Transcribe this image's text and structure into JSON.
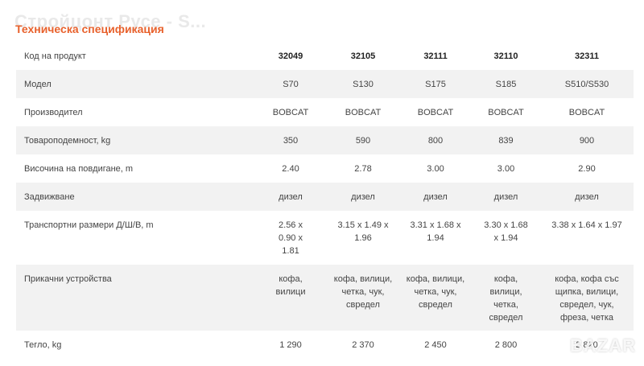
{
  "ghost_title": "Стройцонт Русе - S...",
  "section_title": "Техническа спецификация",
  "table": {
    "rows": [
      {
        "label": "Код на продукт",
        "values": [
          "32049",
          "32105",
          "32111",
          "32110",
          "32311"
        ]
      },
      {
        "label": "Модел",
        "values": [
          "S70",
          "S130",
          "S175",
          "S185",
          "S510/S530"
        ]
      },
      {
        "label": "Производител",
        "values": [
          "BOBCAT",
          "BOBCAT",
          "BOBCAT",
          "BOBCAT",
          "BOBCAT"
        ]
      },
      {
        "label": "Товароподемност, kg",
        "values": [
          "350",
          "590",
          "800",
          "839",
          "900"
        ]
      },
      {
        "label": "Височина на повдигане, m",
        "values": [
          "2.40",
          "2.78",
          "3.00",
          "3.00",
          "2.90"
        ]
      },
      {
        "label": "Задвижване",
        "values": [
          "дизел",
          "дизел",
          "дизел",
          "дизел",
          "дизел"
        ]
      },
      {
        "label": "Транспортни размери Д/Ш/В, m",
        "values": [
          "2.56 x 0.90 x 1.81",
          "3.15 x 1.49 x 1.96",
          "3.31 x 1.68 x 1.94",
          "3.30 x 1.68 x 1.94",
          "3.38 x 1.64 x 1.97"
        ]
      },
      {
        "label": "Прикачни устройства",
        "values": [
          "кофа, вилици",
          "кофа, вилици, четка, чук, свредел",
          "кофа, вилици, четка, чук, свредел",
          "кофа, вилици, четка, свредел",
          "кофа, кофа със щипка, вилици, свредел, чук, фреза, четка"
        ]
      },
      {
        "label": "Тегло, kg",
        "values": [
          "1 290",
          "2 370",
          "2 450",
          "2 800",
          "2 820"
        ]
      }
    ]
  },
  "watermark": "BAZAR"
}
